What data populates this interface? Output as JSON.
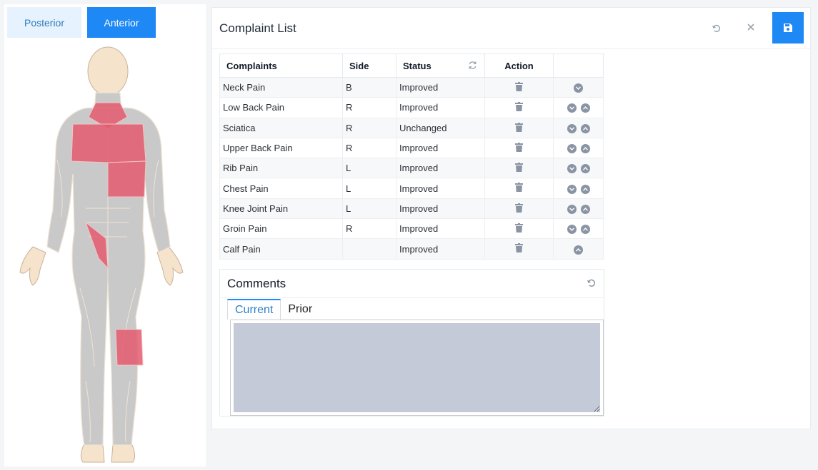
{
  "view_toggle": {
    "posterior_label": "Posterior",
    "anterior_label": "Anterior",
    "active": "Anterior"
  },
  "body_map": {
    "highlight_color": "#e35a6f",
    "highlighted_regions": [
      "neck",
      "chest",
      "upper-abdomen",
      "right-groin",
      "left-knee"
    ]
  },
  "panel": {
    "title": "Complaint List",
    "icons": [
      "undo-icon",
      "close-icon",
      "save-icon"
    ],
    "accent_color": "#1e88f5"
  },
  "table": {
    "headers": {
      "complaints": "Complaints",
      "side": "Side",
      "status": "Status",
      "action": "Action"
    },
    "rows": [
      {
        "name": "Neck Pain",
        "side": "B",
        "status": "Improved",
        "down": true,
        "up": false
      },
      {
        "name": "Low Back Pain",
        "side": "R",
        "status": "Improved",
        "down": true,
        "up": true
      },
      {
        "name": "Sciatica",
        "side": "R",
        "status": "Unchanged",
        "down": true,
        "up": true
      },
      {
        "name": "Upper Back Pain",
        "side": "R",
        "status": "Improved",
        "down": true,
        "up": true
      },
      {
        "name": "Rib Pain",
        "side": "L",
        "status": "Improved",
        "down": true,
        "up": true
      },
      {
        "name": "Chest Pain",
        "side": "L",
        "status": "Improved",
        "down": true,
        "up": true
      },
      {
        "name": "Knee Joint Pain",
        "side": "L",
        "status": "Improved",
        "down": true,
        "up": true
      },
      {
        "name": "Groin Pain",
        "side": "R",
        "status": "Improved",
        "down": true,
        "up": true
      },
      {
        "name": "Calf Pain",
        "side": "",
        "status": "Improved",
        "down": false,
        "up": true
      }
    ]
  },
  "comments": {
    "title": "Comments",
    "tabs": [
      {
        "label": "Current",
        "active": true
      },
      {
        "label": "Prior",
        "active": false
      }
    ],
    "current_value": ""
  }
}
